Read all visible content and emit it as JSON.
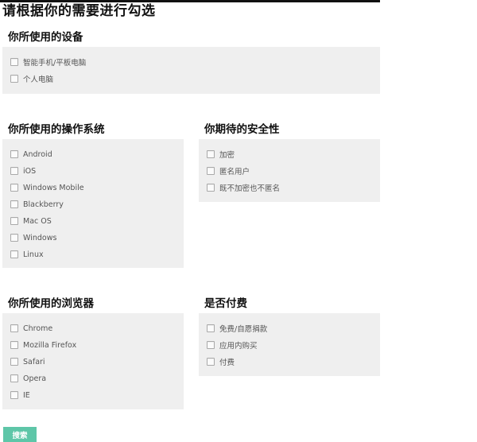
{
  "page_title": "请根据你的需要进行勾选",
  "sections": {
    "device": {
      "title": "你所使用的设备",
      "options": [
        "智能手机/平板电脑",
        "个人电脑"
      ]
    },
    "os": {
      "title": "你所使用的操作系统",
      "options": [
        "Android",
        "iOS",
        "Windows Mobile",
        "Blackberry",
        "Mac OS",
        "Windows",
        "Linux"
      ]
    },
    "security": {
      "title": "你期待的安全性",
      "options": [
        "加密",
        "匿名用户",
        "既不加密也不匿名"
      ]
    },
    "browser": {
      "title": "你所使用的浏览器",
      "options": [
        "Chrome",
        "Mozilla Firefox",
        "Safari",
        "Opera",
        "IE"
      ]
    },
    "payment": {
      "title": "是否付费",
      "options": [
        "免费/自愿捐款",
        "应用内购买",
        "付费"
      ]
    }
  },
  "search_button": "搜索"
}
